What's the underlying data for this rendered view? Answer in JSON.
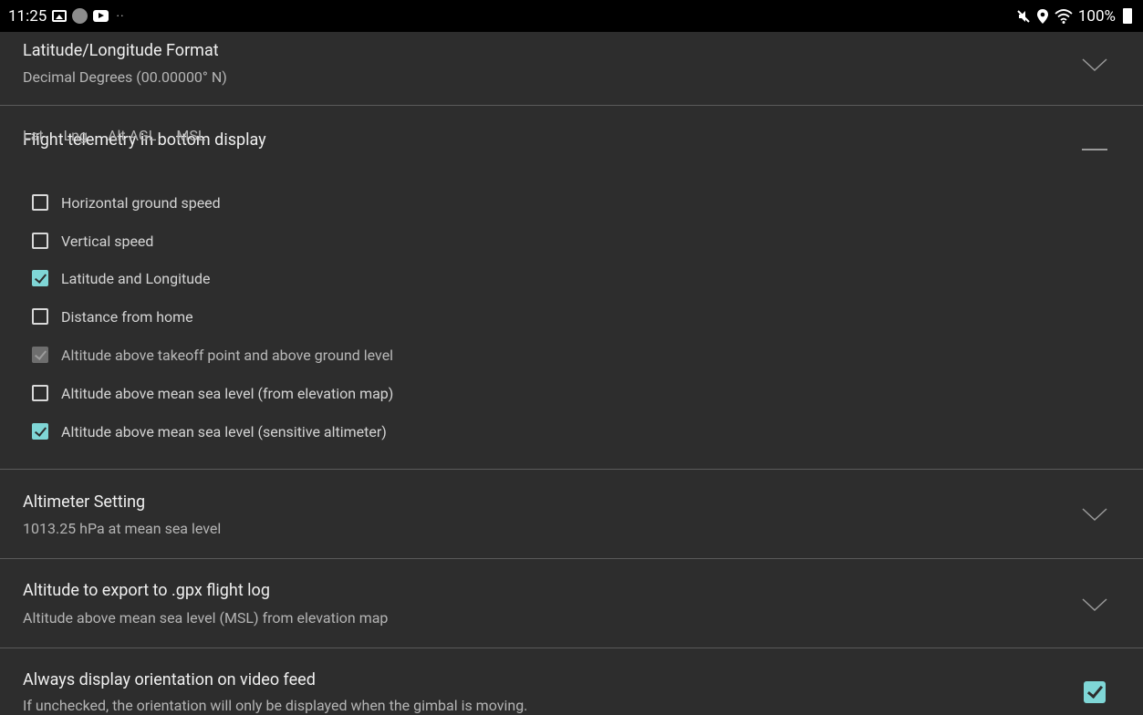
{
  "status_bar": {
    "time": "11:25",
    "left_icons": [
      "gallery-icon",
      "app-circle-icon",
      "youtube-icon",
      "more-dots-icon"
    ],
    "right_icons": [
      "mute-icon",
      "location-icon",
      "wifi-icon",
      "battery-icon"
    ],
    "battery": "100%"
  },
  "settings": {
    "lat_lng_format": {
      "title": "Latitude/Longitude Format",
      "value": "Decimal Degrees (00.00000° N)"
    },
    "flight_telemetry": {
      "title": "Flight telemetry in bottom display",
      "columns": [
        "Lat",
        "Lng",
        "Alt AGL",
        "MSL"
      ],
      "options": [
        {
          "label": "Horizontal ground speed",
          "state": "unchecked"
        },
        {
          "label": "Vertical speed",
          "state": "unchecked"
        },
        {
          "label": "Latitude and Longitude",
          "state": "checked"
        },
        {
          "label": "Distance from home",
          "state": "unchecked"
        },
        {
          "label": "Altitude above takeoff point and above ground level",
          "state": "checked-disabled"
        },
        {
          "label": "Altitude above mean sea level (from elevation map)",
          "state": "unchecked"
        },
        {
          "label": "Altitude above mean sea level (sensitive altimeter)",
          "state": "checked"
        }
      ]
    },
    "altimeter_setting": {
      "title": "Altimeter Setting",
      "value": "1013.25 hPa at mean sea level"
    },
    "gpx_altitude": {
      "title": "Altitude to export to .gpx flight log",
      "value": "Altitude above mean sea level (MSL) from elevation map"
    },
    "orientation": {
      "title": "Always display orientation on video feed",
      "description": "If unchecked, the orientation will only be displayed when the gimbal is moving.",
      "checked": true
    }
  },
  "colors": {
    "background": "#2d2d2d",
    "accent": "#7fd6d6",
    "divider": "#5a5a5a"
  }
}
